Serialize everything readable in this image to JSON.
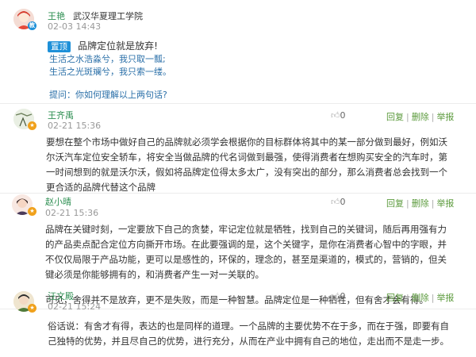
{
  "post": {
    "author": "王艳",
    "school": "武汉华夏理工学院",
    "date": "02-03 14:43",
    "tag": "置顶",
    "title": "品牌定位就是放弃!",
    "quote_lines": [
      "生活之水浩淼兮，我只取一瓢;",
      "生活之光斑斓兮，我只索一缕。"
    ],
    "prompt": "提问：你如何理解以上两句话?",
    "badge": "教"
  },
  "comments": [
    {
      "author": "王齐禹",
      "date": "02-21 15:36",
      "likes": "0",
      "actions": [
        "回复",
        "删除",
        "举报"
      ],
      "body_lines": [
        "要想在整个市场中做好自己的品牌就必须学会根据你的目标群体将其中的某一部分做到最好，例如沃",
        "尔沃汽车定位安全轿车，将安全当做品牌的代名词做到最强，使得消费者在想购买安全的汽车时，第",
        "一时间想到的就是沃尔沃，假如将品牌定位得太多太广，没有突出的部分，那么消费者总会找到一个",
        "更合适的品牌代替这个品牌"
      ]
    },
    {
      "author": "赵小晴",
      "date": "02-21 15:36",
      "likes": "0",
      "actions": [
        "回复",
        "删除",
        "举报"
      ],
      "body_lines": [
        "品牌在关键时刻，一定要放下自己的贪婪，牢记定位就是牺牲，找到自己的关键词，随后再用强有力",
        "的产品卖点配合定位方向撕开市场。在此要强调的是，这个关键字，是你在消费者心智中的字眼，并",
        "不仅仅局限于产品功能，更可以是感性的，环保的，理念的，甚至是渠道的，模式的，营销的，但关",
        "键必须是你能够拥有的，和消费者产生一对一关联的。"
      ],
      "body_lines2": [
        "可见，舍得并不是放弃，更不是失败，而是一种智慧。品牌定位是一种牺牲，但有舍才会有得。"
      ]
    },
    {
      "author": "汪文殿",
      "date": "02-21 15:24",
      "likes": "0",
      "actions": [
        "回复",
        "删除",
        "举报"
      ],
      "body_lines": [
        "俗话说：有舍才有得，表达的也是同样的道理。一个品牌的主要优势不在于多，而在于强，即要有自",
        "己独特的优势，并且尽自己的优势，进行充分，从而在产业中拥有自己的地位，走出而不是走一步。"
      ]
    }
  ]
}
